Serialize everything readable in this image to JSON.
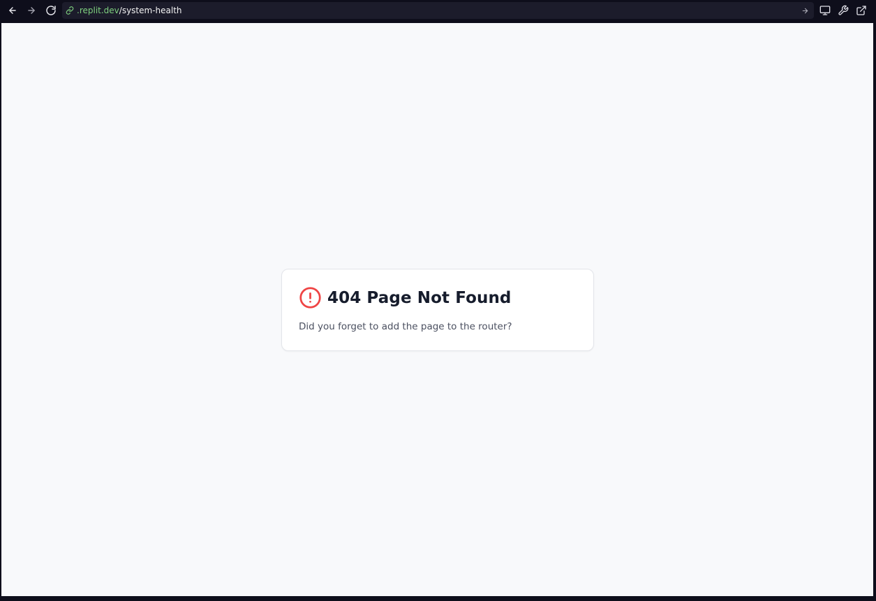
{
  "browser": {
    "url": {
      "domain": ".replit.dev",
      "path": "/system-health"
    },
    "icons": {
      "back": "arrow-left-icon",
      "forward": "arrow-right-icon",
      "reload": "reload-icon",
      "link": "link-icon",
      "go": "arrow-right-icon",
      "device": "monitor-icon",
      "devtools": "wrench-icon",
      "open_external": "external-link-icon"
    },
    "colors": {
      "chrome_bg": "#0e0e1b",
      "urlbar_bg": "#1c1c2b",
      "domain_text": "#7fd17f"
    }
  },
  "page": {
    "background": "#f8f9fb",
    "error_card": {
      "title": "404 Page Not Found",
      "description": "Did you forget to add the page to the router?",
      "icon": "alert-circle-icon",
      "icon_color": "#ef4444"
    }
  }
}
